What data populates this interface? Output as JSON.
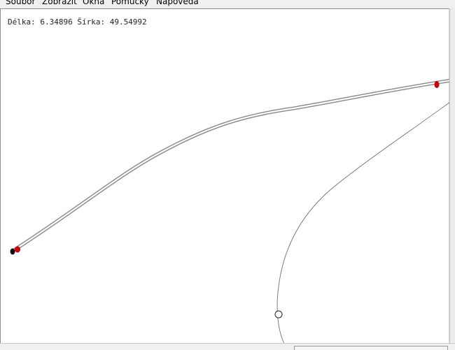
{
  "menubar": {
    "items": [
      {
        "label": "Soubor"
      },
      {
        "label": "Zobrazit"
      },
      {
        "label": "Okna"
      },
      {
        "label": "Pomůcky"
      },
      {
        "label": "Nápověda"
      }
    ]
  },
  "map": {
    "readout": "Délka: 6.34896 Šírka: 49.54992",
    "colors": {
      "track": "#888888",
      "thin_line": "#707070",
      "marker_red": "#cc0000",
      "marker_black": "#111111",
      "circle_marker": "#222222"
    }
  }
}
